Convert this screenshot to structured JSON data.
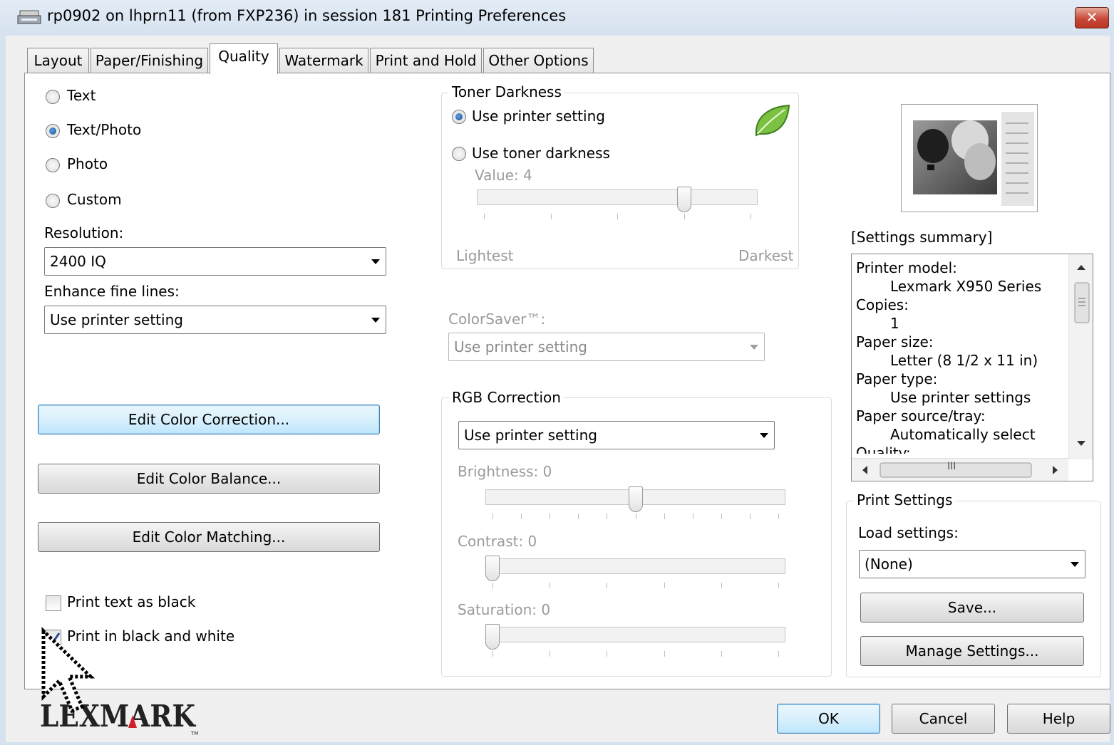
{
  "window": {
    "title": "rp0902 on lhprn11 (from FXP236) in session 181 Printing Preferences",
    "close_label": "✕"
  },
  "tabs": [
    "Layout",
    "Paper/Finishing",
    "Quality",
    "Watermark",
    "Print and Hold",
    "Other Options"
  ],
  "active_tab": "Quality",
  "quality_mode": {
    "options": [
      "Text",
      "Text/Photo",
      "Photo",
      "Custom"
    ],
    "selected": "Text/Photo"
  },
  "resolution": {
    "label": "Resolution:",
    "value": "2400 IQ"
  },
  "enhance_fine_lines": {
    "label": "Enhance fine lines:",
    "value": "Use printer setting"
  },
  "buttons": {
    "edit_color_correction": "Edit Color Correction...",
    "edit_color_balance": "Edit Color Balance...",
    "edit_color_matching": "Edit Color Matching..."
  },
  "checkboxes": {
    "print_text_black": {
      "label": "Print text as black",
      "checked": false
    },
    "print_bw": {
      "label": "Print in black and white",
      "checked": true
    }
  },
  "toner": {
    "title": "Toner Darkness",
    "use_printer": "Use printer setting",
    "use_toner": "Use toner darkness",
    "selected": "Use printer setting",
    "value_label": "Value: 4",
    "value": 4,
    "min": 1,
    "max": 5,
    "lightest": "Lightest",
    "darkest": "Darkest",
    "icon": "leaf-icon"
  },
  "colorsaver": {
    "label": "ColorSaver™:",
    "value": "Use printer setting"
  },
  "rgb": {
    "title": "RGB Correction",
    "value": "Use printer setting",
    "brightness": {
      "label": "Brightness: 0",
      "value": 0,
      "min": -5,
      "max": 5
    },
    "contrast": {
      "label": "Contrast: 0",
      "value": 0,
      "min": 0,
      "max": 5
    },
    "saturation": {
      "label": "Saturation: 0",
      "value": 0,
      "min": 0,
      "max": 5
    }
  },
  "summary": {
    "title": "[Settings summary]",
    "lines": [
      {
        "key": "Printer model:",
        "value": "Lexmark X950 Series"
      },
      {
        "key": "Copies:",
        "value": "1"
      },
      {
        "key": "Paper size:",
        "value": "Letter (8 1/2 x 11 in)"
      },
      {
        "key": "Paper type:",
        "value": "Use printer settings"
      },
      {
        "key": "Paper source/tray:",
        "value": "Automatically select"
      },
      {
        "key": "Quality:",
        "value": ""
      }
    ],
    "hscroll_grip": "III"
  },
  "print_settings": {
    "title": "Print Settings",
    "load_label": "Load settings:",
    "load_value": "(None)",
    "save": "Save...",
    "manage": "Manage Settings..."
  },
  "footer": {
    "logo": "LEXMARK",
    "ok": "OK",
    "cancel": "Cancel",
    "help": "Help"
  }
}
